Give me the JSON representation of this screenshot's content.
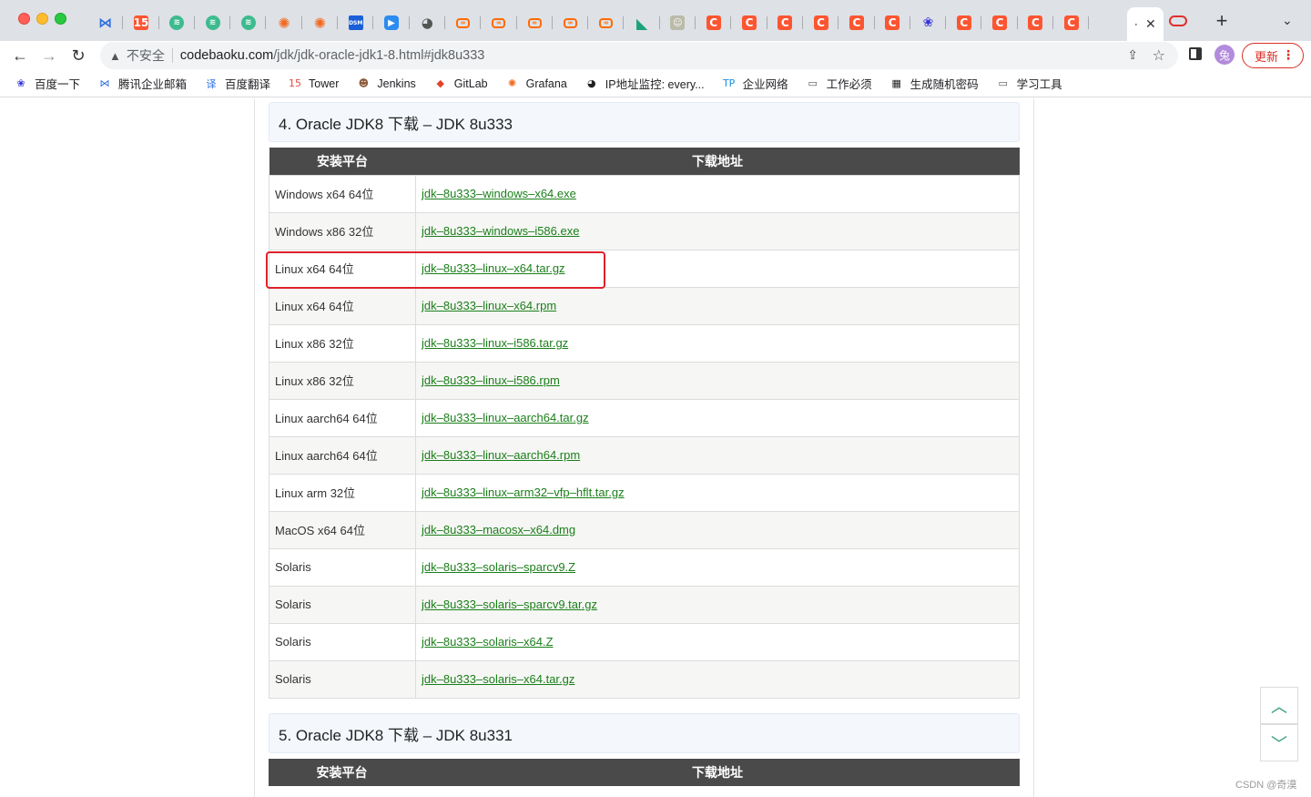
{
  "browser": {
    "tabs": [
      {
        "icon": "x-logo-icon",
        "glyph": "⋈"
      },
      {
        "icon": "calendar-icon",
        "glyph": "15"
      },
      {
        "icon": "stack-icon",
        "glyph": "≋"
      },
      {
        "icon": "stack-icon",
        "glyph": "≋"
      },
      {
        "icon": "stack-icon",
        "glyph": "≋"
      },
      {
        "icon": "grafana-icon",
        "glyph": "✺"
      },
      {
        "icon": "grafana-icon",
        "glyph": "✺"
      },
      {
        "icon": "dsm-icon",
        "glyph": "DSM"
      },
      {
        "icon": "arrow-app-icon",
        "glyph": "▶"
      },
      {
        "icon": "globe-icon",
        "glyph": "◕"
      },
      {
        "icon": "link-icon",
        "glyph": "∞"
      },
      {
        "icon": "link-icon",
        "glyph": "∞"
      },
      {
        "icon": "link-icon",
        "glyph": "∞"
      },
      {
        "icon": "link-icon",
        "glyph": "∞"
      },
      {
        "icon": "link-icon",
        "glyph": "∞"
      },
      {
        "icon": "kotlin-icon",
        "glyph": "◣"
      },
      {
        "icon": "photo-icon",
        "glyph": "☺"
      },
      {
        "icon": "csdn-icon",
        "glyph": "C"
      },
      {
        "icon": "csdn-icon",
        "glyph": "C"
      },
      {
        "icon": "csdn-icon",
        "glyph": "C"
      },
      {
        "icon": "csdn-icon",
        "glyph": "C"
      },
      {
        "icon": "csdn-icon",
        "glyph": "C"
      },
      {
        "icon": "csdn-icon",
        "glyph": "C"
      },
      {
        "icon": "baidu-paw-icon",
        "glyph": "❀"
      },
      {
        "icon": "csdn-icon",
        "glyph": "C"
      },
      {
        "icon": "csdn-icon",
        "glyph": "C"
      },
      {
        "icon": "csdn-icon",
        "glyph": "C"
      },
      {
        "icon": "csdn-icon",
        "glyph": "C"
      }
    ],
    "active_tab": {
      "dot": "⸱",
      "close": "✕"
    },
    "new_tab": "+",
    "tab_menu": "⌄",
    "back": "←",
    "forward": "→",
    "reload": "↻",
    "security_warning": "▲",
    "insecure_label": "不安全",
    "url_host": "codebaoku.com",
    "url_path": "/jdk/jdk-oracle-jdk1-8.html#jdk8u333",
    "share": "⇪",
    "star": "☆",
    "avatar": "兔",
    "update_label": "更新",
    "more": "⋮"
  },
  "bookmarks": [
    {
      "label": "百度一下",
      "icon": "baidu-paw-icon",
      "glyph": "❀",
      "color": "#3535d8"
    },
    {
      "label": "腾讯企业邮箱",
      "icon": "x-logo-icon",
      "glyph": "⋈",
      "color": "#2f6fe0"
    },
    {
      "label": "百度翻译",
      "icon": "translate-icon",
      "glyph": "译",
      "color": "#2c6fe6"
    },
    {
      "label": "Tower",
      "icon": "calendar-icon",
      "glyph": "15",
      "color": "#e64a3c"
    },
    {
      "label": "Jenkins",
      "icon": "jenkins-icon",
      "glyph": "☻",
      "color": "#8b5a3c"
    },
    {
      "label": "GitLab",
      "icon": "gitlab-icon",
      "glyph": "◆",
      "color": "#e24329"
    },
    {
      "label": "Grafana",
      "icon": "grafana-icon",
      "glyph": "✺",
      "color": "#f26a20"
    },
    {
      "label": "IP地址监控: every...",
      "icon": "globe-icon",
      "glyph": "◕",
      "color": "#222"
    },
    {
      "label": "企业网络",
      "icon": "tp-link-icon",
      "glyph": "TP",
      "color": "#1a8fe0"
    },
    {
      "label": "工作必须",
      "icon": "folder-icon",
      "glyph": "▭",
      "color": "#555"
    },
    {
      "label": "生成随机密码",
      "icon": "password-icon",
      "glyph": "▦",
      "color": "#222"
    },
    {
      "label": "学习工具",
      "icon": "folder-icon",
      "glyph": "▭",
      "color": "#555"
    }
  ],
  "section4": {
    "heading": "4. Oracle JDK8 下载 – JDK 8u333",
    "col_platform": "安装平台",
    "col_download": "下载地址",
    "rows": [
      {
        "platform": "Windows x64 64位",
        "file": "jdk–8u333–windows–x64.exe"
      },
      {
        "platform": "Windows x86 32位",
        "file": "jdk–8u333–windows–i586.exe"
      },
      {
        "platform": "Linux x64 64位",
        "file": "jdk–8u333–linux–x64.tar.gz"
      },
      {
        "platform": "Linux x64 64位",
        "file": "jdk–8u333–linux–x64.rpm"
      },
      {
        "platform": "Linux x86 32位",
        "file": "jdk–8u333–linux–i586.tar.gz"
      },
      {
        "platform": "Linux x86 32位",
        "file": "jdk–8u333–linux–i586.rpm"
      },
      {
        "platform": "Linux aarch64 64位",
        "file": "jdk–8u333–linux–aarch64.tar.gz"
      },
      {
        "platform": "Linux aarch64 64位",
        "file": "jdk–8u333–linux–aarch64.rpm"
      },
      {
        "platform": "Linux arm 32位",
        "file": "jdk–8u333–linux–arm32–vfp–hflt.tar.gz"
      },
      {
        "platform": "MacOS x64 64位",
        "file": "jdk–8u333–macosx–x64.dmg"
      },
      {
        "platform": "Solaris",
        "file": "jdk–8u333–solaris–sparcv9.Z"
      },
      {
        "platform": "Solaris",
        "file": "jdk–8u333–solaris–sparcv9.tar.gz"
      },
      {
        "platform": "Solaris",
        "file": "jdk–8u333–solaris–x64.Z"
      },
      {
        "platform": "Solaris",
        "file": "jdk–8u333–solaris–x64.tar.gz"
      }
    ]
  },
  "section5": {
    "heading": "5. Oracle JDK8 下载 – JDK 8u331",
    "col_platform": "安装平台",
    "col_download": "下载地址"
  },
  "scroll": {
    "up": "︿",
    "down": "﹀"
  },
  "watermark": "CSDN @奇漠"
}
